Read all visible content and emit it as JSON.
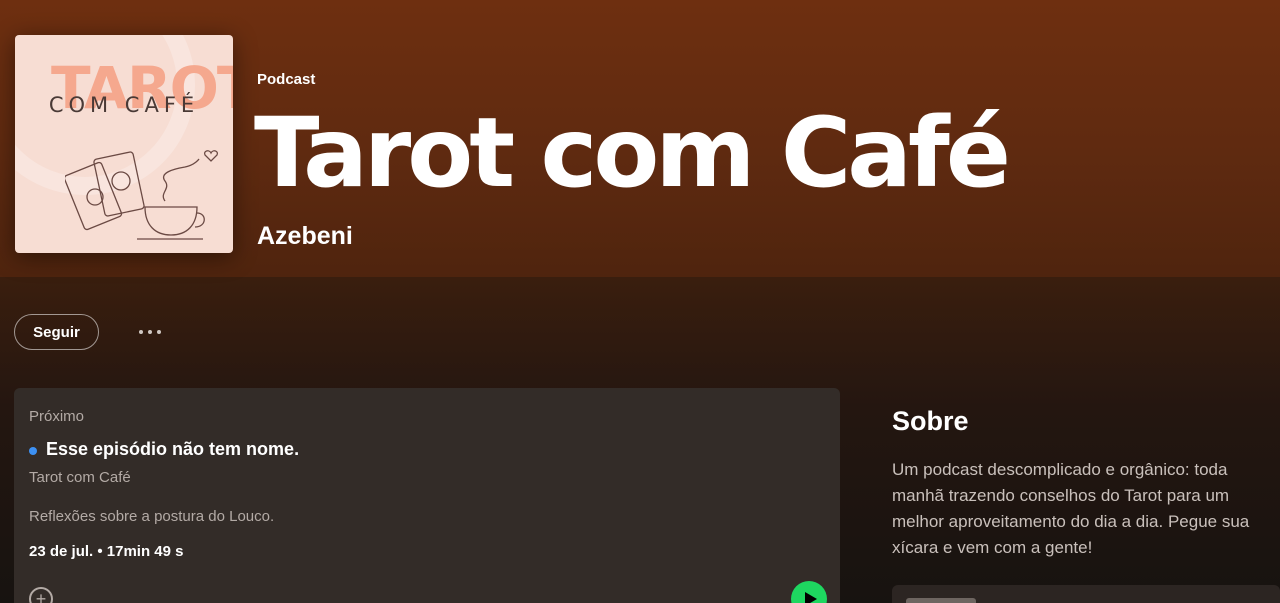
{
  "podcast": {
    "type_label": "Podcast",
    "title": "Tarot com Café",
    "author": "Azebeni",
    "cover": {
      "big_text": "TAROT",
      "small_text": "COM CAFÉ"
    }
  },
  "actions": {
    "follow_label": "Seguir",
    "more_icon": "more-horizontal-icon"
  },
  "next_episode": {
    "section_label": "Próximo",
    "title": "Esse episódio não tem nome.",
    "show": "Tarot com Café",
    "description": "Reflexões sobre a postura do Louco.",
    "meta": "23 de jul. • 17min 49 s",
    "unplayed_color": "#3d91f4",
    "play_color": "#1ed760"
  },
  "about": {
    "title": "Sobre",
    "text": "Um podcast descomplicado e orgânico: toda manhã trazendo conselhos do Tarot para um melhor aproveitamento do dia a dia. Pegue sua xícara e vem com a gente!"
  }
}
